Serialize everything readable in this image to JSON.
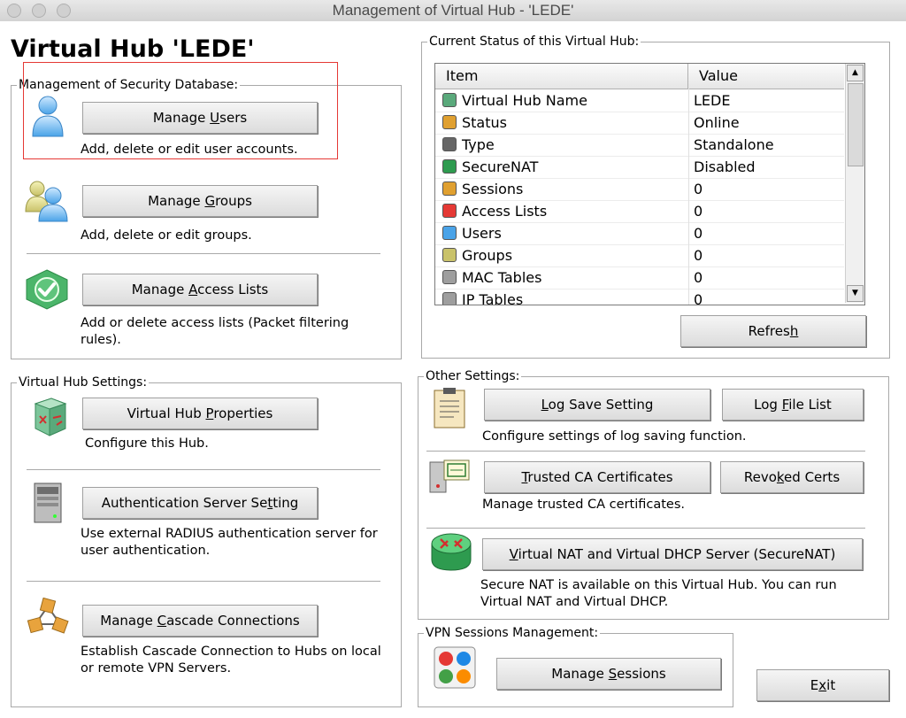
{
  "window": {
    "title": "Management of Virtual Hub - 'LEDE'"
  },
  "hub_title": "Virtual Hub 'LEDE'",
  "security_db": {
    "label": "Management of Security Database:",
    "users": {
      "pre": "Manage ",
      "key": "U",
      "post": "sers",
      "desc": "Add, delete or edit user accounts."
    },
    "groups": {
      "pre": "Manage ",
      "key": "G",
      "post": "roups",
      "desc": "Add, delete or edit groups."
    },
    "access": {
      "pre": "Manage ",
      "key": "A",
      "post": "ccess Lists",
      "desc": "Add or delete access lists (Packet filtering rules)."
    }
  },
  "hub_settings": {
    "label": "Virtual Hub Settings:",
    "props": {
      "pre": "Virtual Hub ",
      "key": "P",
      "post": "roperties",
      "desc": "Configure this Hub."
    },
    "auth": {
      "pre": "Authentication Server Se",
      "key": "t",
      "post": "ting",
      "desc": "Use external RADIUS authentication server for user authentication."
    },
    "cascade": {
      "pre": "Manage ",
      "key": "C",
      "post": "ascade Connections",
      "desc": "Establish Cascade Connection to Hubs on local or remote VPN Servers."
    }
  },
  "status": {
    "label": "Current Status of this Virtual Hub:",
    "columns": [
      "Item",
      "Value"
    ],
    "rows": [
      {
        "icon": "virtual-hub-icon",
        "item": "Virtual Hub Name",
        "value": "LEDE"
      },
      {
        "icon": "status-icon",
        "item": "Status",
        "value": "Online"
      },
      {
        "icon": "type-icon",
        "item": "Type",
        "value": "Standalone"
      },
      {
        "icon": "securenat-icon",
        "item": "SecureNAT",
        "value": "Disabled"
      },
      {
        "icon": "sessions-icon",
        "item": "Sessions",
        "value": "0"
      },
      {
        "icon": "access-lists-icon",
        "item": "Access Lists",
        "value": "0"
      },
      {
        "icon": "users-icon",
        "item": "Users",
        "value": "0"
      },
      {
        "icon": "groups-icon",
        "item": "Groups",
        "value": "0"
      },
      {
        "icon": "mac-tables-icon",
        "item": "MAC Tables",
        "value": "0"
      },
      {
        "icon": "ip-tables-icon",
        "item": "IP Tables",
        "value": "0"
      }
    ],
    "refresh": {
      "pre": "Refres",
      "key": "h",
      "post": ""
    }
  },
  "other": {
    "label": "Other Settings:",
    "log_save": {
      "pre": "",
      "key": "L",
      "post": "og Save Setting"
    },
    "log_list": {
      "pre": "Log ",
      "key": "F",
      "post": "ile List"
    },
    "log_desc": "Configure settings of log saving function.",
    "trusted": {
      "pre": "",
      "key": "T",
      "post": "rusted CA Certificates"
    },
    "revoked": {
      "pre": "Revo",
      "key": "k",
      "post": "ed Certs"
    },
    "trusted_desc": "Manage trusted CA certificates.",
    "nat": {
      "pre": "",
      "key": "V",
      "post": "irtual NAT and Virtual DHCP Server (SecureNAT)"
    },
    "nat_desc": "Secure NAT is available on this Virtual Hub. You can run Virtual NAT and Virtual DHCP."
  },
  "sessions": {
    "label": "VPN Sessions Management:",
    "manage": {
      "pre": "Manage ",
      "key": "S",
      "post": "essions"
    }
  },
  "exit": {
    "pre": "E",
    "key": "x",
    "post": "it"
  }
}
